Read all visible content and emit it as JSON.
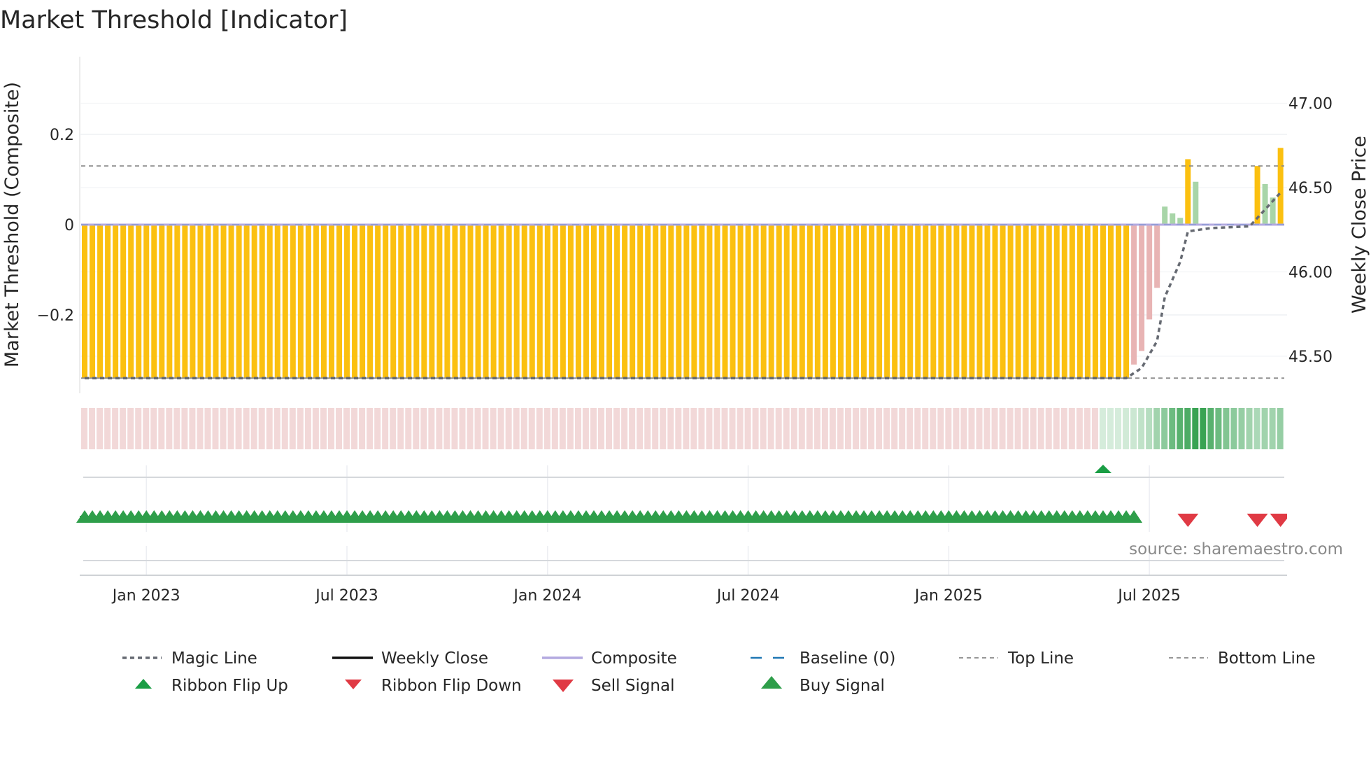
{
  "title": "Market Threshold [Indicator]",
  "source": "source: sharemaestro.com",
  "colors": {
    "yellow": "#fbc010",
    "pink": "#e8b4b4",
    "green_bar": "#a8d5a8",
    "ribbon_pink": "#f2d8d8",
    "ribbon_green": "#2e9e4a",
    "buy": "#2e9e4a",
    "flip_up": "#1a9e45",
    "sell": "#e03a44",
    "composite": "#b3a9e0",
    "magic": "#666a72",
    "baseline": "#1f77b4",
    "refline": "#888888"
  },
  "chart_data": {
    "type": "bar",
    "title": "Market Threshold [Indicator]",
    "ylabel": "Market Threshold (Composite)",
    "y2label": "Weekly Close Price",
    "ylim": [
      -0.36,
      0.38
    ],
    "y2lim": [
      45.3,
      47.2
    ],
    "yticks": [
      {
        "v": 0.2,
        "label": "0.2"
      },
      {
        "v": 0,
        "label": "0"
      },
      {
        "v": -0.2,
        "label": "−0.2"
      }
    ],
    "y2ticks": [
      {
        "v": 47.0,
        "label": "47.00"
      },
      {
        "v": 46.5,
        "label": "46.50"
      },
      {
        "v": 46.0,
        "label": "46.00"
      },
      {
        "v": 45.5,
        "label": "45.50"
      }
    ],
    "x_weeks": 156,
    "xticks": [
      {
        "week": 8,
        "label": "Jan 2023"
      },
      {
        "week": 34,
        "label": "Jul 2023"
      },
      {
        "week": 60,
        "label": "Jan 2024"
      },
      {
        "week": 86,
        "label": "Jul 2024"
      },
      {
        "week": 112,
        "label": "Jan 2025"
      },
      {
        "week": 138,
        "label": "Jul 2025"
      }
    ],
    "top_line": 0.13,
    "bottom_line": -0.34,
    "composite_runs": [
      {
        "color": "yellow",
        "values": [
          -0.34
        ],
        "repeat": 136
      },
      {
        "color": "pink",
        "values": [
          -0.31,
          -0.28,
          -0.21,
          -0.14
        ]
      },
      {
        "color": "green_bar",
        "values": [
          0.04,
          0.025,
          0.015
        ]
      },
      {
        "color": "yellow",
        "values": [
          0.145
        ]
      },
      {
        "color": "green_bar",
        "values": [
          0.095
        ]
      },
      {
        "color": "none",
        "values": [
          0
        ],
        "repeat": 7
      },
      {
        "color": "yellow",
        "values": [
          0.13
        ]
      },
      {
        "color": "green_bar",
        "values": [
          0.09,
          0.06
        ]
      },
      {
        "color": "yellow",
        "values": [
          0.17
        ]
      }
    ],
    "magic_line": [
      [
        0,
        45.37
      ],
      [
        135,
        45.37
      ],
      [
        137,
        45.43
      ],
      [
        139,
        45.59
      ],
      [
        140,
        45.85
      ],
      [
        142,
        46.06
      ],
      [
        143,
        46.24
      ],
      [
        146,
        46.26
      ],
      [
        151,
        46.27
      ],
      [
        153,
        46.37
      ],
      [
        155,
        46.47
      ]
    ],
    "ribbon": {
      "pink_weeks": 132,
      "green_strength": [
        0.2,
        0.2,
        0.2,
        0.22,
        0.25,
        0.3,
        0.35,
        0.45,
        0.55,
        0.7,
        0.8,
        0.85,
        0.95,
        0.95,
        0.8,
        0.7,
        0.6,
        0.55,
        0.5,
        0.45,
        0.4,
        0.45,
        0.45,
        0.5
      ]
    },
    "ribbon_flip_up": [
      132
    ],
    "ribbon_flip_down": [],
    "buy_signals_range": [
      0,
      136
    ],
    "sell_signals": [
      143,
      152,
      155
    ]
  },
  "legend": [
    {
      "label": "Magic Line",
      "kind": "dotted",
      "color": "magic"
    },
    {
      "label": "Weekly Close",
      "kind": "solid",
      "color": "black"
    },
    {
      "label": "Composite",
      "kind": "solid",
      "color": "composite"
    },
    {
      "label": "Baseline (0)",
      "kind": "dash",
      "color": "baseline"
    },
    {
      "label": "Top Line",
      "kind": "thindash",
      "color": "refline"
    },
    {
      "label": "Bottom Line",
      "kind": "thindash",
      "color": "refline"
    },
    {
      "label": "Ribbon Flip Up",
      "kind": "tri-up-small",
      "color": "flip_up"
    },
    {
      "label": "Ribbon Flip Down",
      "kind": "tri-down-small",
      "color": "sell"
    },
    {
      "label": "Sell Signal",
      "kind": "tri-down",
      "color": "sell"
    },
    {
      "label": "Buy Signal",
      "kind": "tri-up",
      "color": "buy"
    }
  ]
}
